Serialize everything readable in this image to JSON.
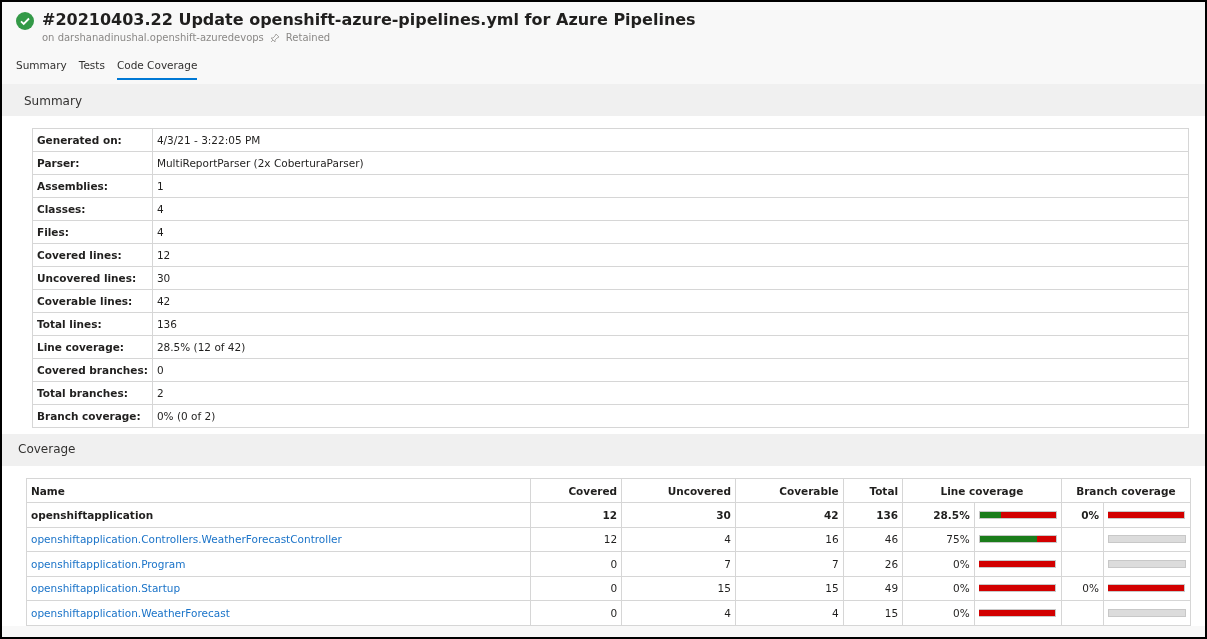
{
  "header": {
    "succeeded": true,
    "title": "#20210403.22 Update openshift-azure-pipelines.yml for Azure Pipelines",
    "source": "on darshanadinushal.openshift-azuredevops",
    "retained": "Retained"
  },
  "tabs": [
    {
      "label": "Summary",
      "selected": false
    },
    {
      "label": "Tests",
      "selected": false
    },
    {
      "label": "Code Coverage",
      "selected": true
    }
  ],
  "summary": {
    "title": "Summary",
    "rows": [
      {
        "label": "Generated on:",
        "value": "4/3/21 - 3:22:05 PM"
      },
      {
        "label": "Parser:",
        "value": "MultiReportParser (2x CoberturaParser)"
      },
      {
        "label": "Assemblies:",
        "value": "1"
      },
      {
        "label": "Classes:",
        "value": "4"
      },
      {
        "label": "Files:",
        "value": "4"
      },
      {
        "label": "Covered lines:",
        "value": "12"
      },
      {
        "label": "Uncovered lines:",
        "value": "30"
      },
      {
        "label": "Coverable lines:",
        "value": "42"
      },
      {
        "label": "Total lines:",
        "value": "136"
      },
      {
        "label": "Line coverage:",
        "value": "28.5% (12 of 42)"
      },
      {
        "label": "Covered branches:",
        "value": "0"
      },
      {
        "label": "Total branches:",
        "value": "2"
      },
      {
        "label": "Branch coverage:",
        "value": "0% (0 of 2)"
      }
    ]
  },
  "coverage": {
    "title": "Coverage",
    "columns": [
      "Name",
      "Covered",
      "Uncovered",
      "Coverable",
      "Total",
      "Line coverage",
      "Branch coverage"
    ],
    "rows": [
      {
        "kind": "assembly",
        "name": "openshiftapplication",
        "covered": "12",
        "uncovered": "30",
        "coverable": "42",
        "total": "136",
        "line_coverage": {
          "reading": "28.5%",
          "level": 0.285
        },
        "branch_coverage": {
          "reading": "0%",
          "level": 0
        }
      },
      {
        "kind": "class",
        "name": "openshiftapplication.Controllers.WeatherForecastController",
        "covered": "12",
        "uncovered": "4",
        "coverable": "16",
        "total": "46",
        "line_coverage": {
          "reading": "75%",
          "level": 0.75
        }
      },
      {
        "kind": "class",
        "name": "openshiftapplication.Program",
        "covered": "0",
        "uncovered": "7",
        "coverable": "7",
        "total": "26",
        "line_coverage": {
          "reading": "0%",
          "level": 0
        }
      },
      {
        "kind": "class",
        "name": "openshiftapplication.Startup",
        "covered": "0",
        "uncovered": "15",
        "coverable": "15",
        "total": "49",
        "line_coverage": {
          "reading": "0%",
          "level": 0
        },
        "branch_coverage": {
          "reading": "0%",
          "level": 0
        }
      },
      {
        "kind": "class",
        "name": "openshiftapplication.WeatherForecast",
        "covered": "0",
        "uncovered": "4",
        "coverable": "4",
        "total": "15",
        "line_coverage": {
          "reading": "0%",
          "level": 0
        }
      }
    ]
  }
}
